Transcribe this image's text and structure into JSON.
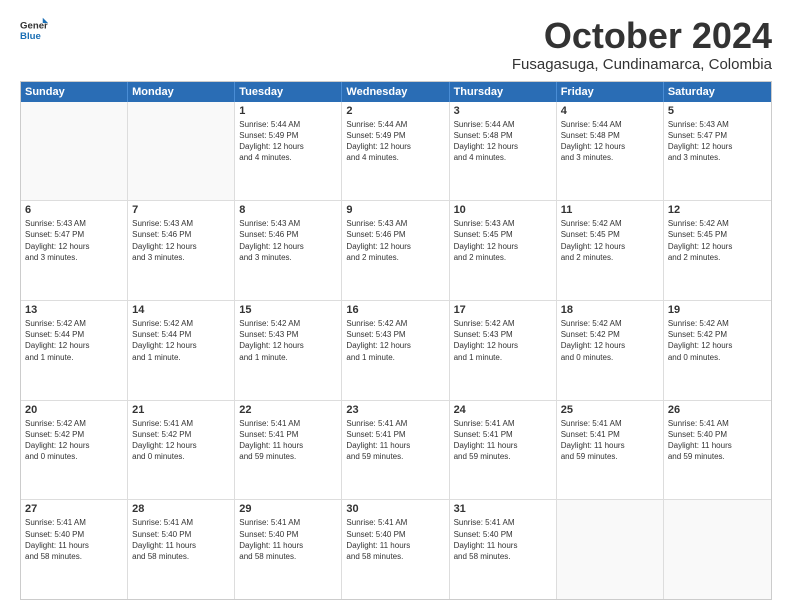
{
  "logo": {
    "line1": "General",
    "line2": "Blue"
  },
  "title": "October 2024",
  "subtitle": "Fusagasuga, Cundinamarca, Colombia",
  "days_of_week": [
    "Sunday",
    "Monday",
    "Tuesday",
    "Wednesday",
    "Thursday",
    "Friday",
    "Saturday"
  ],
  "weeks": [
    [
      {
        "day": "",
        "info": ""
      },
      {
        "day": "",
        "info": ""
      },
      {
        "day": "1",
        "info": "Sunrise: 5:44 AM\nSunset: 5:49 PM\nDaylight: 12 hours\nand 4 minutes."
      },
      {
        "day": "2",
        "info": "Sunrise: 5:44 AM\nSunset: 5:49 PM\nDaylight: 12 hours\nand 4 minutes."
      },
      {
        "day": "3",
        "info": "Sunrise: 5:44 AM\nSunset: 5:48 PM\nDaylight: 12 hours\nand 4 minutes."
      },
      {
        "day": "4",
        "info": "Sunrise: 5:44 AM\nSunset: 5:48 PM\nDaylight: 12 hours\nand 3 minutes."
      },
      {
        "day": "5",
        "info": "Sunrise: 5:43 AM\nSunset: 5:47 PM\nDaylight: 12 hours\nand 3 minutes."
      }
    ],
    [
      {
        "day": "6",
        "info": "Sunrise: 5:43 AM\nSunset: 5:47 PM\nDaylight: 12 hours\nand 3 minutes."
      },
      {
        "day": "7",
        "info": "Sunrise: 5:43 AM\nSunset: 5:46 PM\nDaylight: 12 hours\nand 3 minutes."
      },
      {
        "day": "8",
        "info": "Sunrise: 5:43 AM\nSunset: 5:46 PM\nDaylight: 12 hours\nand 3 minutes."
      },
      {
        "day": "9",
        "info": "Sunrise: 5:43 AM\nSunset: 5:46 PM\nDaylight: 12 hours\nand 2 minutes."
      },
      {
        "day": "10",
        "info": "Sunrise: 5:43 AM\nSunset: 5:45 PM\nDaylight: 12 hours\nand 2 minutes."
      },
      {
        "day": "11",
        "info": "Sunrise: 5:42 AM\nSunset: 5:45 PM\nDaylight: 12 hours\nand 2 minutes."
      },
      {
        "day": "12",
        "info": "Sunrise: 5:42 AM\nSunset: 5:45 PM\nDaylight: 12 hours\nand 2 minutes."
      }
    ],
    [
      {
        "day": "13",
        "info": "Sunrise: 5:42 AM\nSunset: 5:44 PM\nDaylight: 12 hours\nand 1 minute."
      },
      {
        "day": "14",
        "info": "Sunrise: 5:42 AM\nSunset: 5:44 PM\nDaylight: 12 hours\nand 1 minute."
      },
      {
        "day": "15",
        "info": "Sunrise: 5:42 AM\nSunset: 5:43 PM\nDaylight: 12 hours\nand 1 minute."
      },
      {
        "day": "16",
        "info": "Sunrise: 5:42 AM\nSunset: 5:43 PM\nDaylight: 12 hours\nand 1 minute."
      },
      {
        "day": "17",
        "info": "Sunrise: 5:42 AM\nSunset: 5:43 PM\nDaylight: 12 hours\nand 1 minute."
      },
      {
        "day": "18",
        "info": "Sunrise: 5:42 AM\nSunset: 5:42 PM\nDaylight: 12 hours\nand 0 minutes."
      },
      {
        "day": "19",
        "info": "Sunrise: 5:42 AM\nSunset: 5:42 PM\nDaylight: 12 hours\nand 0 minutes."
      }
    ],
    [
      {
        "day": "20",
        "info": "Sunrise: 5:42 AM\nSunset: 5:42 PM\nDaylight: 12 hours\nand 0 minutes."
      },
      {
        "day": "21",
        "info": "Sunrise: 5:41 AM\nSunset: 5:42 PM\nDaylight: 12 hours\nand 0 minutes."
      },
      {
        "day": "22",
        "info": "Sunrise: 5:41 AM\nSunset: 5:41 PM\nDaylight: 11 hours\nand 59 minutes."
      },
      {
        "day": "23",
        "info": "Sunrise: 5:41 AM\nSunset: 5:41 PM\nDaylight: 11 hours\nand 59 minutes."
      },
      {
        "day": "24",
        "info": "Sunrise: 5:41 AM\nSunset: 5:41 PM\nDaylight: 11 hours\nand 59 minutes."
      },
      {
        "day": "25",
        "info": "Sunrise: 5:41 AM\nSunset: 5:41 PM\nDaylight: 11 hours\nand 59 minutes."
      },
      {
        "day": "26",
        "info": "Sunrise: 5:41 AM\nSunset: 5:40 PM\nDaylight: 11 hours\nand 59 minutes."
      }
    ],
    [
      {
        "day": "27",
        "info": "Sunrise: 5:41 AM\nSunset: 5:40 PM\nDaylight: 11 hours\nand 58 minutes."
      },
      {
        "day": "28",
        "info": "Sunrise: 5:41 AM\nSunset: 5:40 PM\nDaylight: 11 hours\nand 58 minutes."
      },
      {
        "day": "29",
        "info": "Sunrise: 5:41 AM\nSunset: 5:40 PM\nDaylight: 11 hours\nand 58 minutes."
      },
      {
        "day": "30",
        "info": "Sunrise: 5:41 AM\nSunset: 5:40 PM\nDaylight: 11 hours\nand 58 minutes."
      },
      {
        "day": "31",
        "info": "Sunrise: 5:41 AM\nSunset: 5:40 PM\nDaylight: 11 hours\nand 58 minutes."
      },
      {
        "day": "",
        "info": ""
      },
      {
        "day": "",
        "info": ""
      }
    ]
  ]
}
